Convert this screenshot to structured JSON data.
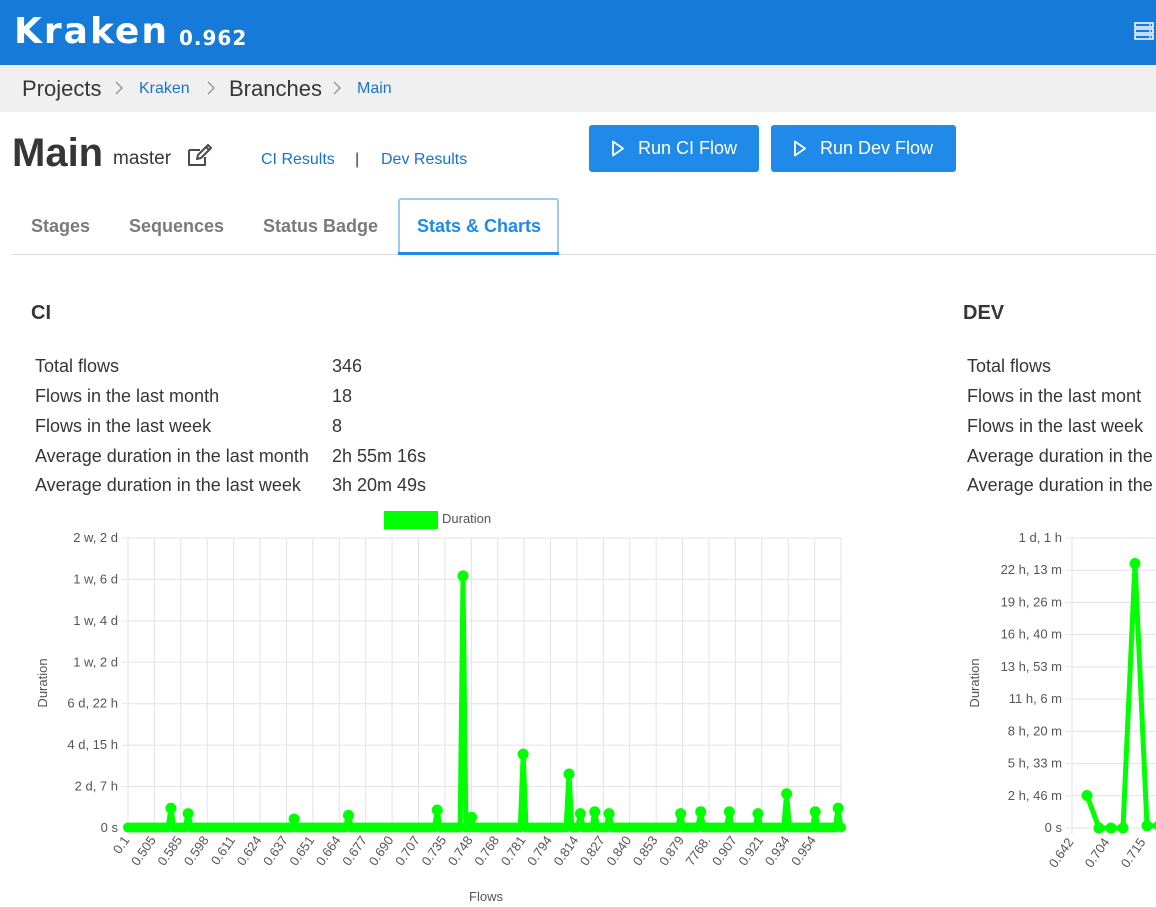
{
  "app": {
    "name": "Kraken",
    "version": "0.962"
  },
  "breadcrumb": {
    "items": [
      {
        "label": "Projects",
        "link": false
      },
      {
        "label": "Kraken",
        "link": true
      },
      {
        "label": "Branches",
        "link": false
      },
      {
        "label": "Main",
        "link": true
      }
    ]
  },
  "branch": {
    "title": "Main",
    "git_branch": "master"
  },
  "results_links": {
    "ci": "CI Results",
    "separator": "|",
    "dev": "Dev Results"
  },
  "buttons": {
    "run_ci": "Run CI Flow",
    "run_dev": "Run Dev Flow"
  },
  "tabs": [
    {
      "label": "Stages",
      "active": false
    },
    {
      "label": "Sequences",
      "active": false
    },
    {
      "label": "Status Badge",
      "active": false
    },
    {
      "label": "Stats & Charts",
      "active": true
    }
  ],
  "colors": {
    "brand": "#167bd8",
    "button": "#1f8ae8",
    "link": "#1a73c8",
    "series": "#00ff00"
  },
  "ci": {
    "title": "CI",
    "stats": [
      {
        "label": "Total flows",
        "value": "346"
      },
      {
        "label": "Flows in the last month",
        "value": "18"
      },
      {
        "label": "Flows in the last week",
        "value": "8"
      },
      {
        "label": "Average duration in the last month",
        "value": "2h 55m 16s"
      },
      {
        "label": "Average duration in the last week",
        "value": "3h 20m 49s"
      }
    ]
  },
  "dev": {
    "title": "DEV",
    "stats": [
      {
        "label": "Total flows"
      },
      {
        "label": "Flows in the last mont"
      },
      {
        "label": "Flows in the last week"
      },
      {
        "label": "Average duration in the"
      },
      {
        "label": "Average duration in the"
      }
    ]
  },
  "chart_data": [
    {
      "type": "line",
      "legend": "Duration",
      "ylabel": "Duration",
      "xlabel": "Flows",
      "y_tick_labels": [
        "0 s",
        "2 d, 7 h",
        "4 d, 15 h",
        "6 d, 22 h",
        "1 w, 2 d",
        "1 w, 4 d",
        "1 w, 6 d",
        "2 w, 2 d"
      ],
      "ylim_days": [
        0,
        16.1
      ],
      "x_tick_labels": [
        "0.1",
        "0.505",
        "0.585",
        "0.598",
        "0.611",
        "0.624",
        "0.637",
        "0.651",
        "0.664",
        "0.677",
        "0.690",
        "0.707",
        "0.735",
        "0.748",
        "0.768",
        "0.781",
        "0.794",
        "0.814",
        "0.827",
        "0.840",
        "0.853",
        "0.879",
        "7768.",
        "0.907",
        "0.921",
        "0.934",
        "0.954"
      ],
      "grid": true,
      "legend_position": "top",
      "n_flows": 200,
      "notable_points_days": [
        {
          "flow": 15,
          "y": 1.1
        },
        {
          "flow": 21,
          "y": 0.8
        },
        {
          "flow": 58,
          "y": 0.5
        },
        {
          "flow": 77,
          "y": 0.7
        },
        {
          "flow": 108,
          "y": 1.0
        },
        {
          "flow": 117,
          "y": 14.0
        },
        {
          "flow": 120,
          "y": 0.6
        },
        {
          "flow": 138,
          "y": 4.1
        },
        {
          "flow": 154,
          "y": 3.0
        },
        {
          "flow": 158,
          "y": 0.8
        },
        {
          "flow": 163,
          "y": 0.9
        },
        {
          "flow": 168,
          "y": 0.8
        },
        {
          "flow": 193,
          "y": 0.8
        },
        {
          "flow": 200,
          "y": 0.9
        },
        {
          "flow": 210,
          "y": 0.9
        },
        {
          "flow": 220,
          "y": 0.8
        },
        {
          "flow": 230,
          "y": 1.9
        },
        {
          "flow": 240,
          "y": 0.9
        },
        {
          "flow": 248,
          "y": 1.1
        }
      ]
    },
    {
      "type": "line",
      "ylabel": "Duration",
      "y_tick_labels": [
        "0 s",
        "2 h, 46 m",
        "5 h, 33 m",
        "8 h, 20 m",
        "11 h, 6 m",
        "13 h, 53 m",
        "16 h, 40 m",
        "19 h, 26 m",
        "22 h, 13 m",
        "1 d, 1 h"
      ],
      "ylim_hours": [
        0,
        25
      ],
      "x_tick_labels": [
        "0.642",
        "0.704",
        "0.715"
      ],
      "grid": true,
      "x": [
        0,
        1,
        2,
        3,
        4,
        5,
        6
      ],
      "y_hours": [
        2.8,
        0.0,
        0.0,
        0.0,
        22.8,
        0.2,
        0.2
      ]
    }
  ]
}
